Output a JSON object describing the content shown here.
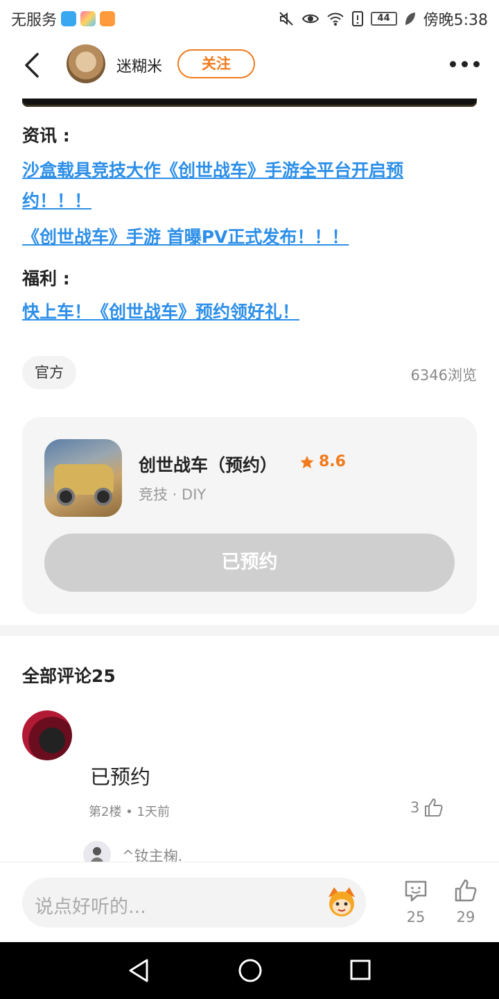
{
  "status_bar": {
    "carrier": "无服务",
    "battery": "44",
    "time": "傍晚5:38"
  },
  "header": {
    "author_name": "迷糊米",
    "follow_label": "关注"
  },
  "article": {
    "news_heading": "资讯 :",
    "link1": "沙盒载具竞技大作《创世战车》手游全平台开启预约！！！",
    "link2": "《创世战车》手游 首曝PV正式发布！！！",
    "welfare_heading": "福利 :",
    "link3": "快上车！《创世战车》预约领好礼！",
    "tag": "官方",
    "views": "6346浏览"
  },
  "game_card": {
    "title": "创世战车（预约）",
    "rating": "8.6",
    "category": "竞技 · DIY",
    "button_label": "已预约"
  },
  "comments": {
    "heading": "全部评论25",
    "items": [
      {
        "text": "已预约",
        "meta": "第2楼 • 1天前",
        "likes": "3",
        "reply_name": "^钕主椈."
      }
    ]
  },
  "bottom_bar": {
    "placeholder": "说点好听的...",
    "comment_count": "25",
    "like_count": "29"
  },
  "colors": {
    "accent": "#f07a1c",
    "link": "#2d8fe8"
  }
}
